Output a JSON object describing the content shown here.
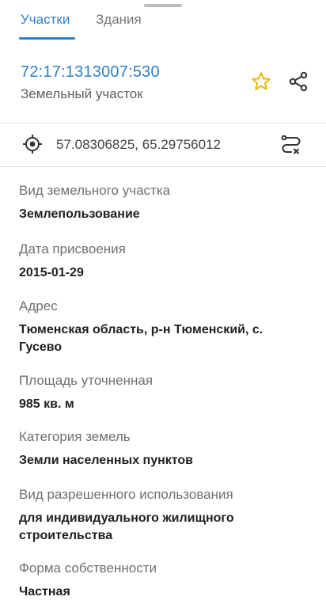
{
  "tabs": [
    {
      "label": "Участки",
      "active": true
    },
    {
      "label": "Здания",
      "active": false
    }
  ],
  "header": {
    "cadastral_number": "72:17:1313007:530",
    "object_type": "Земельный участок",
    "favorite_icon": "star-outline-icon",
    "share_icon": "share-icon",
    "accent_color": "#2f80c8",
    "star_color": "#e8b800"
  },
  "location": {
    "coordinates": "57.08306825, 65.29756012",
    "locate_icon": "crosshair-icon",
    "route_icon": "route-icon"
  },
  "properties": [
    {
      "label": "Вид земельного участка",
      "value": "Землепользование"
    },
    {
      "label": "Дата присвоения",
      "value": "2015-01-29"
    },
    {
      "label": "Адрес",
      "value": "Тюменская область, р-н Тюменский, с. Гусево"
    },
    {
      "label": "Площадь уточненная",
      "value": "985 кв. м"
    },
    {
      "label": "Категория земель",
      "value": "Земли населенных пунктов"
    },
    {
      "label": "Вид разрешенного использования",
      "value": "для индивидуального жилищного строительства"
    },
    {
      "label": "Форма собственности",
      "value": "Частная"
    }
  ]
}
